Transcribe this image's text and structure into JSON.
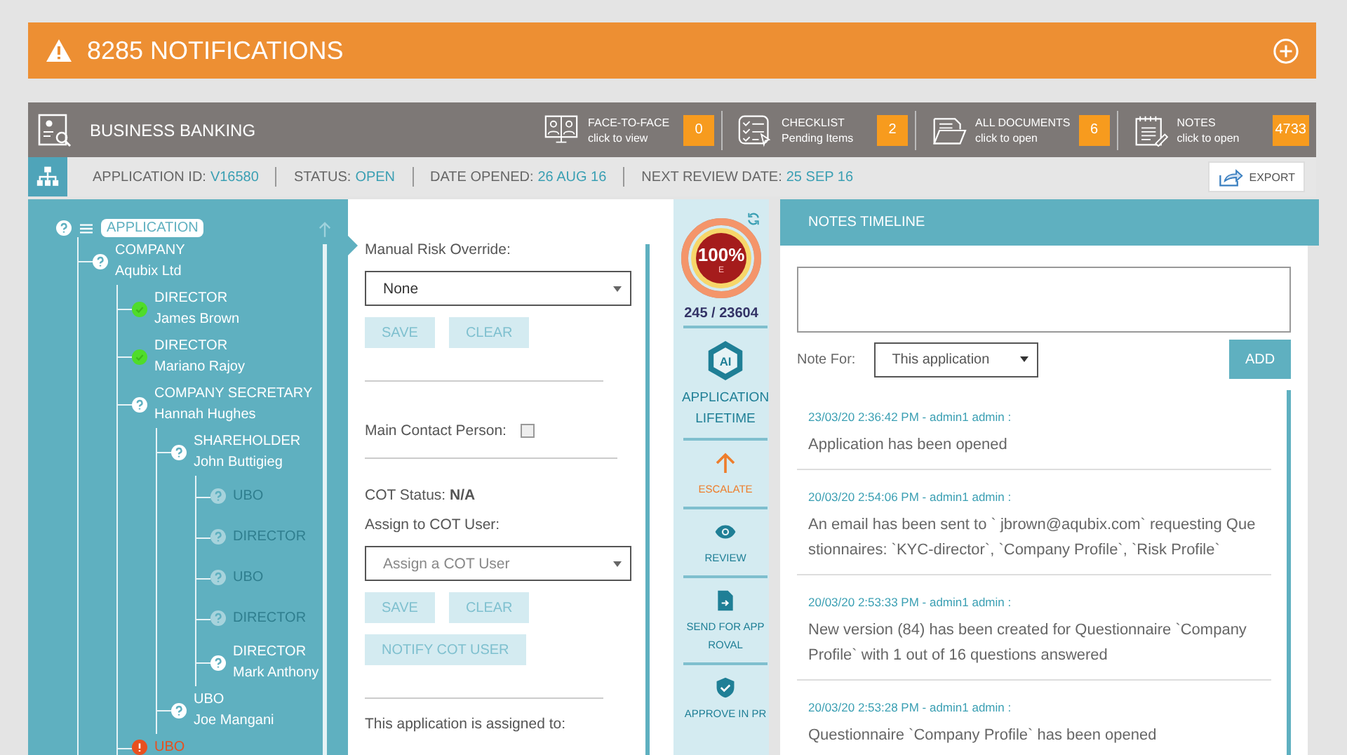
{
  "banner": {
    "title": "8285 NOTIFICATIONS"
  },
  "header": {
    "title": "BUSINESS BANKING",
    "tiles": [
      {
        "kind": "meeting",
        "title": "FACE-TO-FACE",
        "subtitle": "click to view",
        "count": "0"
      },
      {
        "kind": "checklist",
        "title": "CHECKLIST",
        "subtitle": "Pending Items",
        "count": "2"
      },
      {
        "kind": "documents",
        "title": "ALL DOCUMENTS",
        "subtitle": "click to open",
        "count": "6"
      },
      {
        "kind": "notes",
        "title": "NOTES",
        "subtitle": "click to open",
        "count": "4733"
      }
    ]
  },
  "info_bar": {
    "fields": [
      {
        "label": "APPLICATION ID:",
        "value": "V16580"
      },
      {
        "label": "STATUS:",
        "value": "OPEN"
      },
      {
        "label": "DATE OPENED:",
        "value": "26 AUG 16"
      },
      {
        "label": "NEXT REVIEW DATE:",
        "value": "25 SEP 16"
      }
    ],
    "export": "EXPORT"
  },
  "tree": {
    "root": "APPLICATION",
    "children": [
      {
        "role": "COMPANY",
        "name": "Aqubix Ltd",
        "kind": "unknown",
        "disabled": false,
        "children": [
          {
            "role": "DIRECTOR",
            "name": "James Brown",
            "kind": "done",
            "disabled": false
          },
          {
            "role": "DIRECTOR",
            "name": "Mariano Rajoy",
            "kind": "done",
            "disabled": false
          },
          {
            "role": "COMPANY SECRETARY",
            "name": "Hannah Hughes",
            "kind": "unknown",
            "disabled": false,
            "children": [
              {
                "role": "SHAREHOLDER",
                "name": "John Buttigieg",
                "kind": "unknown",
                "disabled": false,
                "children": [
                  {
                    "role": "UBO",
                    "kind": "unknown",
                    "disabled": true
                  },
                  {
                    "role": "DIRECTOR",
                    "kind": "unknown",
                    "disabled": true
                  },
                  {
                    "role": "UBO",
                    "kind": "unknown",
                    "disabled": true
                  },
                  {
                    "role": "DIRECTOR",
                    "kind": "unknown",
                    "disabled": true
                  },
                  {
                    "role": "DIRECTOR",
                    "name": "Mark Anthony",
                    "kind": "unknown",
                    "disabled": false
                  }
                ]
              },
              {
                "role": "UBO",
                "name": "Joe Mangani",
                "kind": "unknown",
                "disabled": false
              }
            ]
          },
          {
            "role": "UBO",
            "kind": "error",
            "disabled": false
          }
        ]
      }
    ]
  },
  "form": {
    "risk_label": "Manual Risk Override:",
    "risk_value": "None",
    "save": "SAVE",
    "clear": "CLEAR",
    "contact_label": "Main Contact Person:",
    "contact_checked": false,
    "cot_status": "COT Status: **N/A**",
    "assign_label": "Assign to COT User:",
    "assign_placeholder": "Assign a COT User",
    "save2": "SAVE",
    "clear2": "CLEAR",
    "notify": "NOTIFY COT USER",
    "assigned_text": "This application is assigned to:"
  },
  "score": {
    "percent": "100%",
    "grade": "E",
    "level": 1,
    "count": "245 / 23604"
  },
  "actions": [
    {
      "kind": "ai",
      "badge": "AI",
      "label_lines": [
        "APPLICATION",
        "LIFETIME"
      ]
    },
    {
      "kind": "escalate",
      "label_lines": [
        "ESCALATE"
      ]
    },
    {
      "kind": "review",
      "label_lines": [
        "REVIEW"
      ]
    },
    {
      "kind": "send",
      "label_lines": [
        "SEND FOR APP",
        "ROVAL"
      ]
    },
    {
      "kind": "approve",
      "label_lines": [
        "APPROVE IN PR"
      ]
    }
  ],
  "notes": {
    "title": "NOTES TIMELINE",
    "note_for_label": "Note For:",
    "note_for_value": "This application",
    "add": "ADD",
    "entries": [
      {
        "meta": "23/03/20 2:36:42 PM - admin1 admin :",
        "text": "Application has been opened"
      },
      {
        "meta": "20/03/20 2:54:06 PM - admin1 admin :",
        "text": "An email has been sent to ` jbrown@aqubix.com` requesting Questionnaires: `KYC-director`, `Company Profile`, `Risk Profile`"
      },
      {
        "meta": "20/03/20 2:53:33 PM - admin1 admin :",
        "text": "New version (84) has been created for Questionnaire `Company Profile` with 1 out of 16 questions answered"
      },
      {
        "meta": "20/03/20 2:53:28 PM - admin1 admin :",
        "text": "Questionnaire `Company Profile` has been opened"
      }
    ]
  }
}
